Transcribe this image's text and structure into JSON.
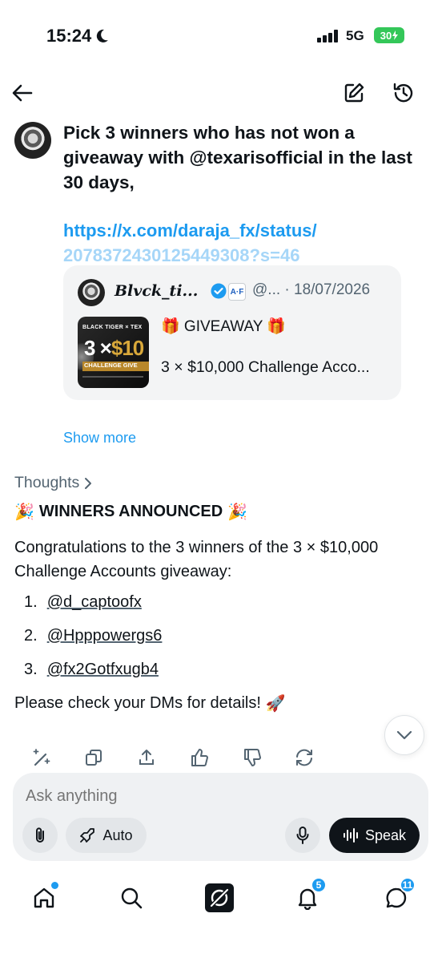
{
  "status_bar": {
    "time": "15:24",
    "network": "5G",
    "battery": "30"
  },
  "prompt": {
    "text": "Pick 3 winners who has not won a giveaway with @texarisofficial in the last 30 days,",
    "link_line1": "https://x.com/daraja_fx/status/",
    "link_line2": "2078372430125449308?s=46"
  },
  "quote": {
    "name": "𝑩𝒍𝒗𝒄𝒌_𝒕𝒊...",
    "affiliate_badge": "A·F",
    "meta": "@... · 18/07/2026",
    "title": "🎁 GIVEAWAY 🎁",
    "description": "3 × $10,000 Challenge Acco...",
    "thumb": {
      "line1": "BLACK TIGER × TEX",
      "line2a": "3 ×",
      "line2b": "$10",
      "line3": "CHALLENGE GIVE"
    }
  },
  "show_more": "Show more",
  "response": {
    "thoughts": "Thoughts",
    "heading": "WINNERS ANNOUNCED",
    "heading_emoji": "🎉",
    "congrats": "Congratulations to the 3 winners of the 3 × $10,000 Challenge Accounts giveaway:",
    "winners": [
      {
        "n": "1.",
        "handle": "@d_captoofx"
      },
      {
        "n": "2.",
        "handle": "@Hpppowergs6"
      },
      {
        "n": "3.",
        "handle": "@fx2Gotfxugb4"
      }
    ],
    "closing": "Please check your DMs for details!",
    "closing_emoji": "🚀"
  },
  "composer": {
    "placeholder": "Ask anything",
    "mode": "Auto",
    "speak": "Speak"
  },
  "nav": {
    "notifications_badge": "5",
    "messages_badge": "11"
  }
}
